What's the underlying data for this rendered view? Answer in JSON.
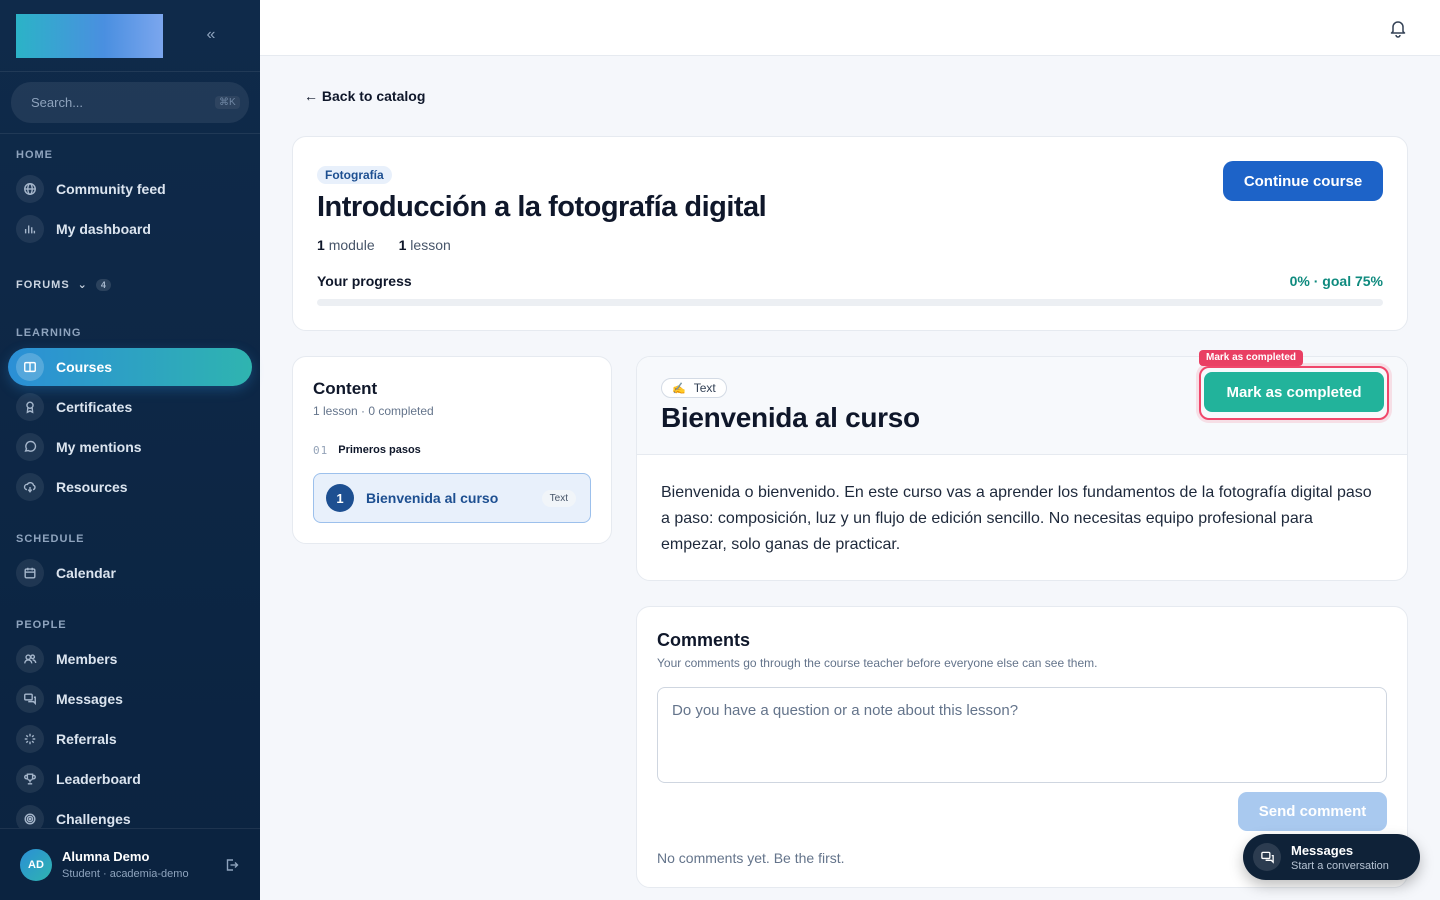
{
  "sidebar": {
    "search_placeholder": "Search...",
    "search_shortcut": "⌘K",
    "sections": {
      "home": "HOME",
      "forums": "FORUMS",
      "forums_count": "4",
      "learning": "LEARNING",
      "schedule": "SCHEDULE",
      "people": "PEOPLE"
    },
    "items": {
      "community_feed": "Community feed",
      "my_dashboard": "My dashboard",
      "courses": "Courses",
      "certificates": "Certificates",
      "my_mentions": "My mentions",
      "resources": "Resources",
      "calendar": "Calendar",
      "members": "Members",
      "messages": "Messages",
      "referrals": "Referrals",
      "leaderboard": "Leaderboard",
      "challenges": "Challenges"
    },
    "active_item": "courses",
    "user": {
      "initials": "AD",
      "name": "Alumna Demo",
      "role": "Student · academia-demo"
    }
  },
  "back_link": "← Back to catalog",
  "course": {
    "category": "Fotografía",
    "title": "Introducción a la fotografía digital",
    "modules_count": "1",
    "modules_label": "module",
    "lessons_count": "1",
    "lessons_label": "lesson",
    "progress_label": "Your progress",
    "progress_text": "0% · goal 75%",
    "progress_fraction": 0,
    "continue_label": "Continue course"
  },
  "content_panel": {
    "title": "Content",
    "subtitle": "1 lesson · 0 completed",
    "module_number": "01",
    "module_name": "Primeros pasos",
    "lessons": [
      {
        "number": "1",
        "name": "Bienvenida al curso",
        "type": "Text"
      }
    ]
  },
  "lesson": {
    "type_icon": "✍️",
    "type_label": "Text",
    "title": "Bienvenida al curso",
    "body": "Bienvenida o bienvenido. En este curso vas a aprender los fundamentos de la fotografía digital paso a paso: composición, luz y un flujo de edición sencillo. No necesitas equipo profesional para empezar, solo ganas de practicar.",
    "mark_completed_label": "Mark as completed",
    "highlight_tag": "Mark as completed"
  },
  "comments": {
    "title": "Comments",
    "subtitle": "Your comments go through the course teacher before everyone else can see them.",
    "placeholder": "Do you have a question or a note about this lesson?",
    "send_label": "Send comment",
    "empty_text": "No comments yet. Be the first."
  },
  "messages_fab": {
    "title": "Messages",
    "subtitle": "Start a conversation"
  },
  "colors": {
    "sidebar_bg": "#0f2a4a",
    "primary": "#1d63c8",
    "accent": "#22b39b",
    "highlight": "#f0476b"
  }
}
